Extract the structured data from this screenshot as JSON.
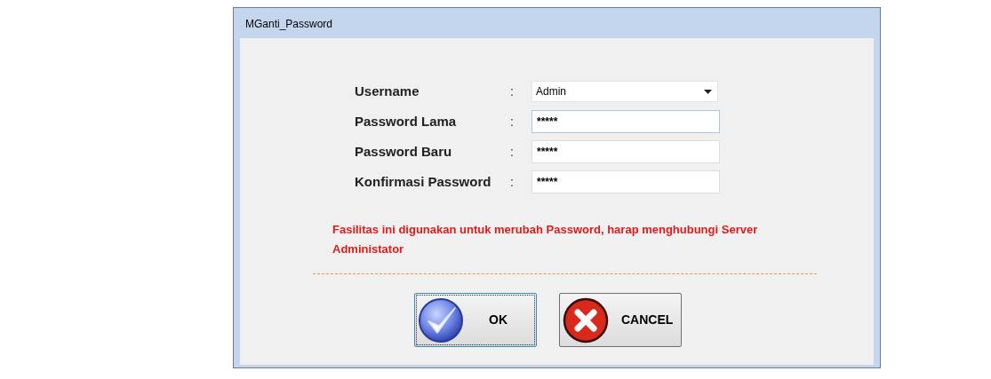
{
  "window": {
    "title": "MGanti_Password"
  },
  "fields": [
    {
      "label": "Username",
      "separator": ":",
      "kind": "dropdown",
      "value": "Admin",
      "focused": false
    },
    {
      "label": "Password Lama",
      "separator": ":",
      "kind": "text",
      "value": "*****",
      "focused": true
    },
    {
      "label": "Password Baru",
      "separator": ":",
      "kind": "text",
      "value": "*****",
      "focused": false
    },
    {
      "label": "Konfirmasi Password",
      "separator": ":",
      "kind": "text",
      "value": "*****",
      "focused": false
    }
  ],
  "message": "Fasilitas ini digunakan untuk merubah Password, harap menghubungi Server Administator",
  "buttons": [
    {
      "label": "OK",
      "kind": "ok",
      "focused": true
    },
    {
      "label": "CANCEL",
      "kind": "cancel",
      "focused": false
    }
  ]
}
